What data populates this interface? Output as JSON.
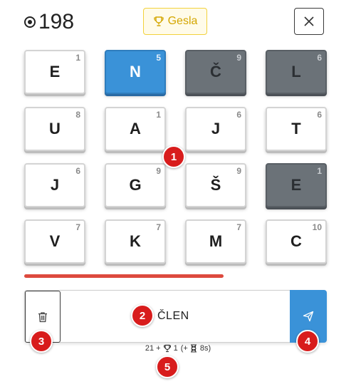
{
  "header": {
    "coins": "198",
    "hints_label": "Gesla"
  },
  "tiles": [
    {
      "letter": "E",
      "score": "1",
      "state": "normal"
    },
    {
      "letter": "N",
      "score": "5",
      "state": "selected"
    },
    {
      "letter": "Č",
      "score": "9",
      "state": "used"
    },
    {
      "letter": "L",
      "score": "6",
      "state": "used"
    },
    {
      "letter": "U",
      "score": "8",
      "state": "normal"
    },
    {
      "letter": "A",
      "score": "1",
      "state": "normal"
    },
    {
      "letter": "J",
      "score": "6",
      "state": "normal"
    },
    {
      "letter": "T",
      "score": "6",
      "state": "normal"
    },
    {
      "letter": "J",
      "score": "6",
      "state": "normal"
    },
    {
      "letter": "G",
      "score": "9",
      "state": "normal"
    },
    {
      "letter": "Š",
      "score": "9",
      "state": "normal"
    },
    {
      "letter": "E",
      "score": "1",
      "state": "used"
    },
    {
      "letter": "V",
      "score": "7",
      "state": "normal"
    },
    {
      "letter": "K",
      "score": "7",
      "state": "normal"
    },
    {
      "letter": "M",
      "score": "7",
      "state": "normal"
    },
    {
      "letter": "C",
      "score": "10",
      "state": "normal"
    }
  ],
  "word_bar": {
    "current_word": "ČLEN"
  },
  "score_line": {
    "points": "21 +",
    "trophy_bonus": "1",
    "time_bonus_open": "(+",
    "time_bonus": "8s)"
  },
  "markers": [
    "1",
    "2",
    "3",
    "4",
    "5"
  ],
  "colors": {
    "selected_tile": "#3a92d8",
    "used_tile": "#6b7278",
    "progress": "#dd4a3e",
    "marker": "#d81c1c",
    "hint": "#f2d23c"
  }
}
